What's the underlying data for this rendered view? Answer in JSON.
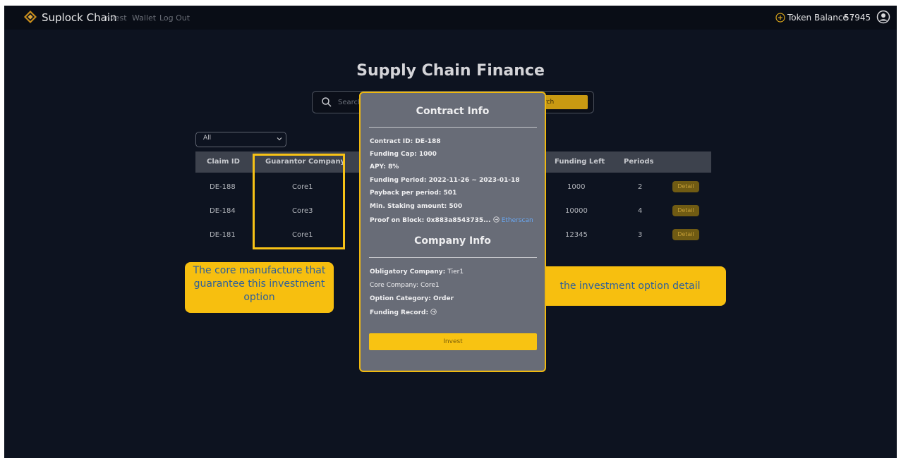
{
  "nav": {
    "brand": "Suplock Chain",
    "links": [
      "Invest",
      "Wallet",
      "Log Out"
    ],
    "token_label": "Token Balance :",
    "token_value": "57945"
  },
  "page": {
    "title": "Supply Chain Finance"
  },
  "search": {
    "placeholder": "Search",
    "button_label": "rch"
  },
  "filter": {
    "selected": "All"
  },
  "table": {
    "headers": [
      "Claim ID",
      "Guarantor Company",
      "Funding Left",
      "Periods"
    ],
    "rows": [
      {
        "claim_id": "DE-188",
        "guarantor": "Core1",
        "funding_left": "1000",
        "periods": "2",
        "action": "Detail"
      },
      {
        "claim_id": "DE-184",
        "guarantor": "Core3",
        "funding_left": "10000",
        "periods": "4",
        "action": "Detail"
      },
      {
        "claim_id": "DE-181",
        "guarantor": "Core1",
        "funding_left": "12345",
        "periods": "3",
        "action": "Detail"
      }
    ]
  },
  "modal": {
    "contract_heading": "Contract Info",
    "contract_fields": [
      {
        "label": "Contract ID:",
        "value": "DE-188"
      },
      {
        "label": "Funding Cap:",
        "value": "1000"
      },
      {
        "label": "APY:",
        "value": "8%"
      },
      {
        "label": "Funding Period:",
        "value": "2022-11-26 ~ 2023-01-18"
      },
      {
        "label": "Payback per period:",
        "value": "501"
      },
      {
        "label": "Min. Staking amount:",
        "value": "500"
      },
      {
        "label": "Proof on Block:",
        "value": "0x883a8543735...",
        "link": "Etherscan"
      }
    ],
    "company_heading": "Company Info",
    "company_fields": [
      {
        "label": "Obligatory Company:",
        "value": "Tier1"
      },
      {
        "label": "Core Company:",
        "value": "Core1"
      },
      {
        "label": "Option Category:",
        "value": "Order"
      },
      {
        "label": "Funding Record:",
        "value": ""
      }
    ],
    "invest_label": "Invest"
  },
  "annotations": {
    "left": "The core manufacture that guarantee this investment option",
    "right": "the investment option detail"
  },
  "colors": {
    "background": "#0d1320",
    "accent": "#f7c216",
    "modal": "#686c77",
    "link": "#68a7f2",
    "callout_text": "#2c5f9c"
  },
  "icons": [
    "logo-icon",
    "token-icon",
    "user-icon",
    "search-icon",
    "chevron-down-icon",
    "circle-arrow-icon"
  ]
}
